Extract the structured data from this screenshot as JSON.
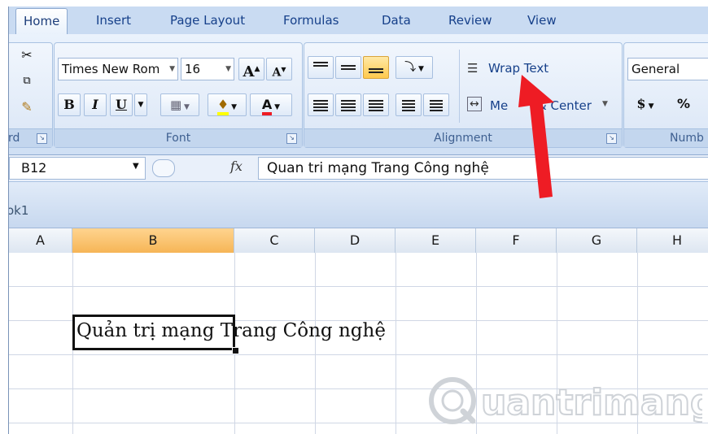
{
  "tabs": [
    "Home",
    "Insert",
    "Page Layout",
    "Formulas",
    "Data",
    "Review",
    "View"
  ],
  "ribbon": {
    "clipboard": {
      "label_fragment": "rd"
    },
    "font": {
      "label": "Font",
      "name": "Times New Rom",
      "size": "16",
      "grow_label": "A",
      "shrink_label": "A",
      "bold": "B",
      "italic": "I",
      "underline": "U",
      "font_color_label": "A"
    },
    "alignment": {
      "label": "Alignment",
      "wrap_text": "Wrap Text",
      "merge_center_left": "Me",
      "merge_center_right": "& Center"
    },
    "number": {
      "label_fragment": "Numb",
      "format": "General",
      "currency": "$",
      "percent": "%"
    }
  },
  "formula_bar": {
    "name_box": "B12",
    "fx": "fx",
    "content": "Quan tri mạng Trang Công nghệ"
  },
  "workbook": {
    "name_fragment": "ok1"
  },
  "grid": {
    "columns": [
      "A",
      "B",
      "C",
      "D",
      "E",
      "F",
      "G",
      "H"
    ],
    "selected_column": "B",
    "cell_text": "Quản trị mạng Trang Công nghệ"
  },
  "watermark": {
    "text": "uantrimang"
  },
  "colors": {
    "ribbon": "#dde9f8",
    "selection": "#f6b556",
    "arrow": "#ee1c24",
    "tab_text": "#16408a"
  }
}
